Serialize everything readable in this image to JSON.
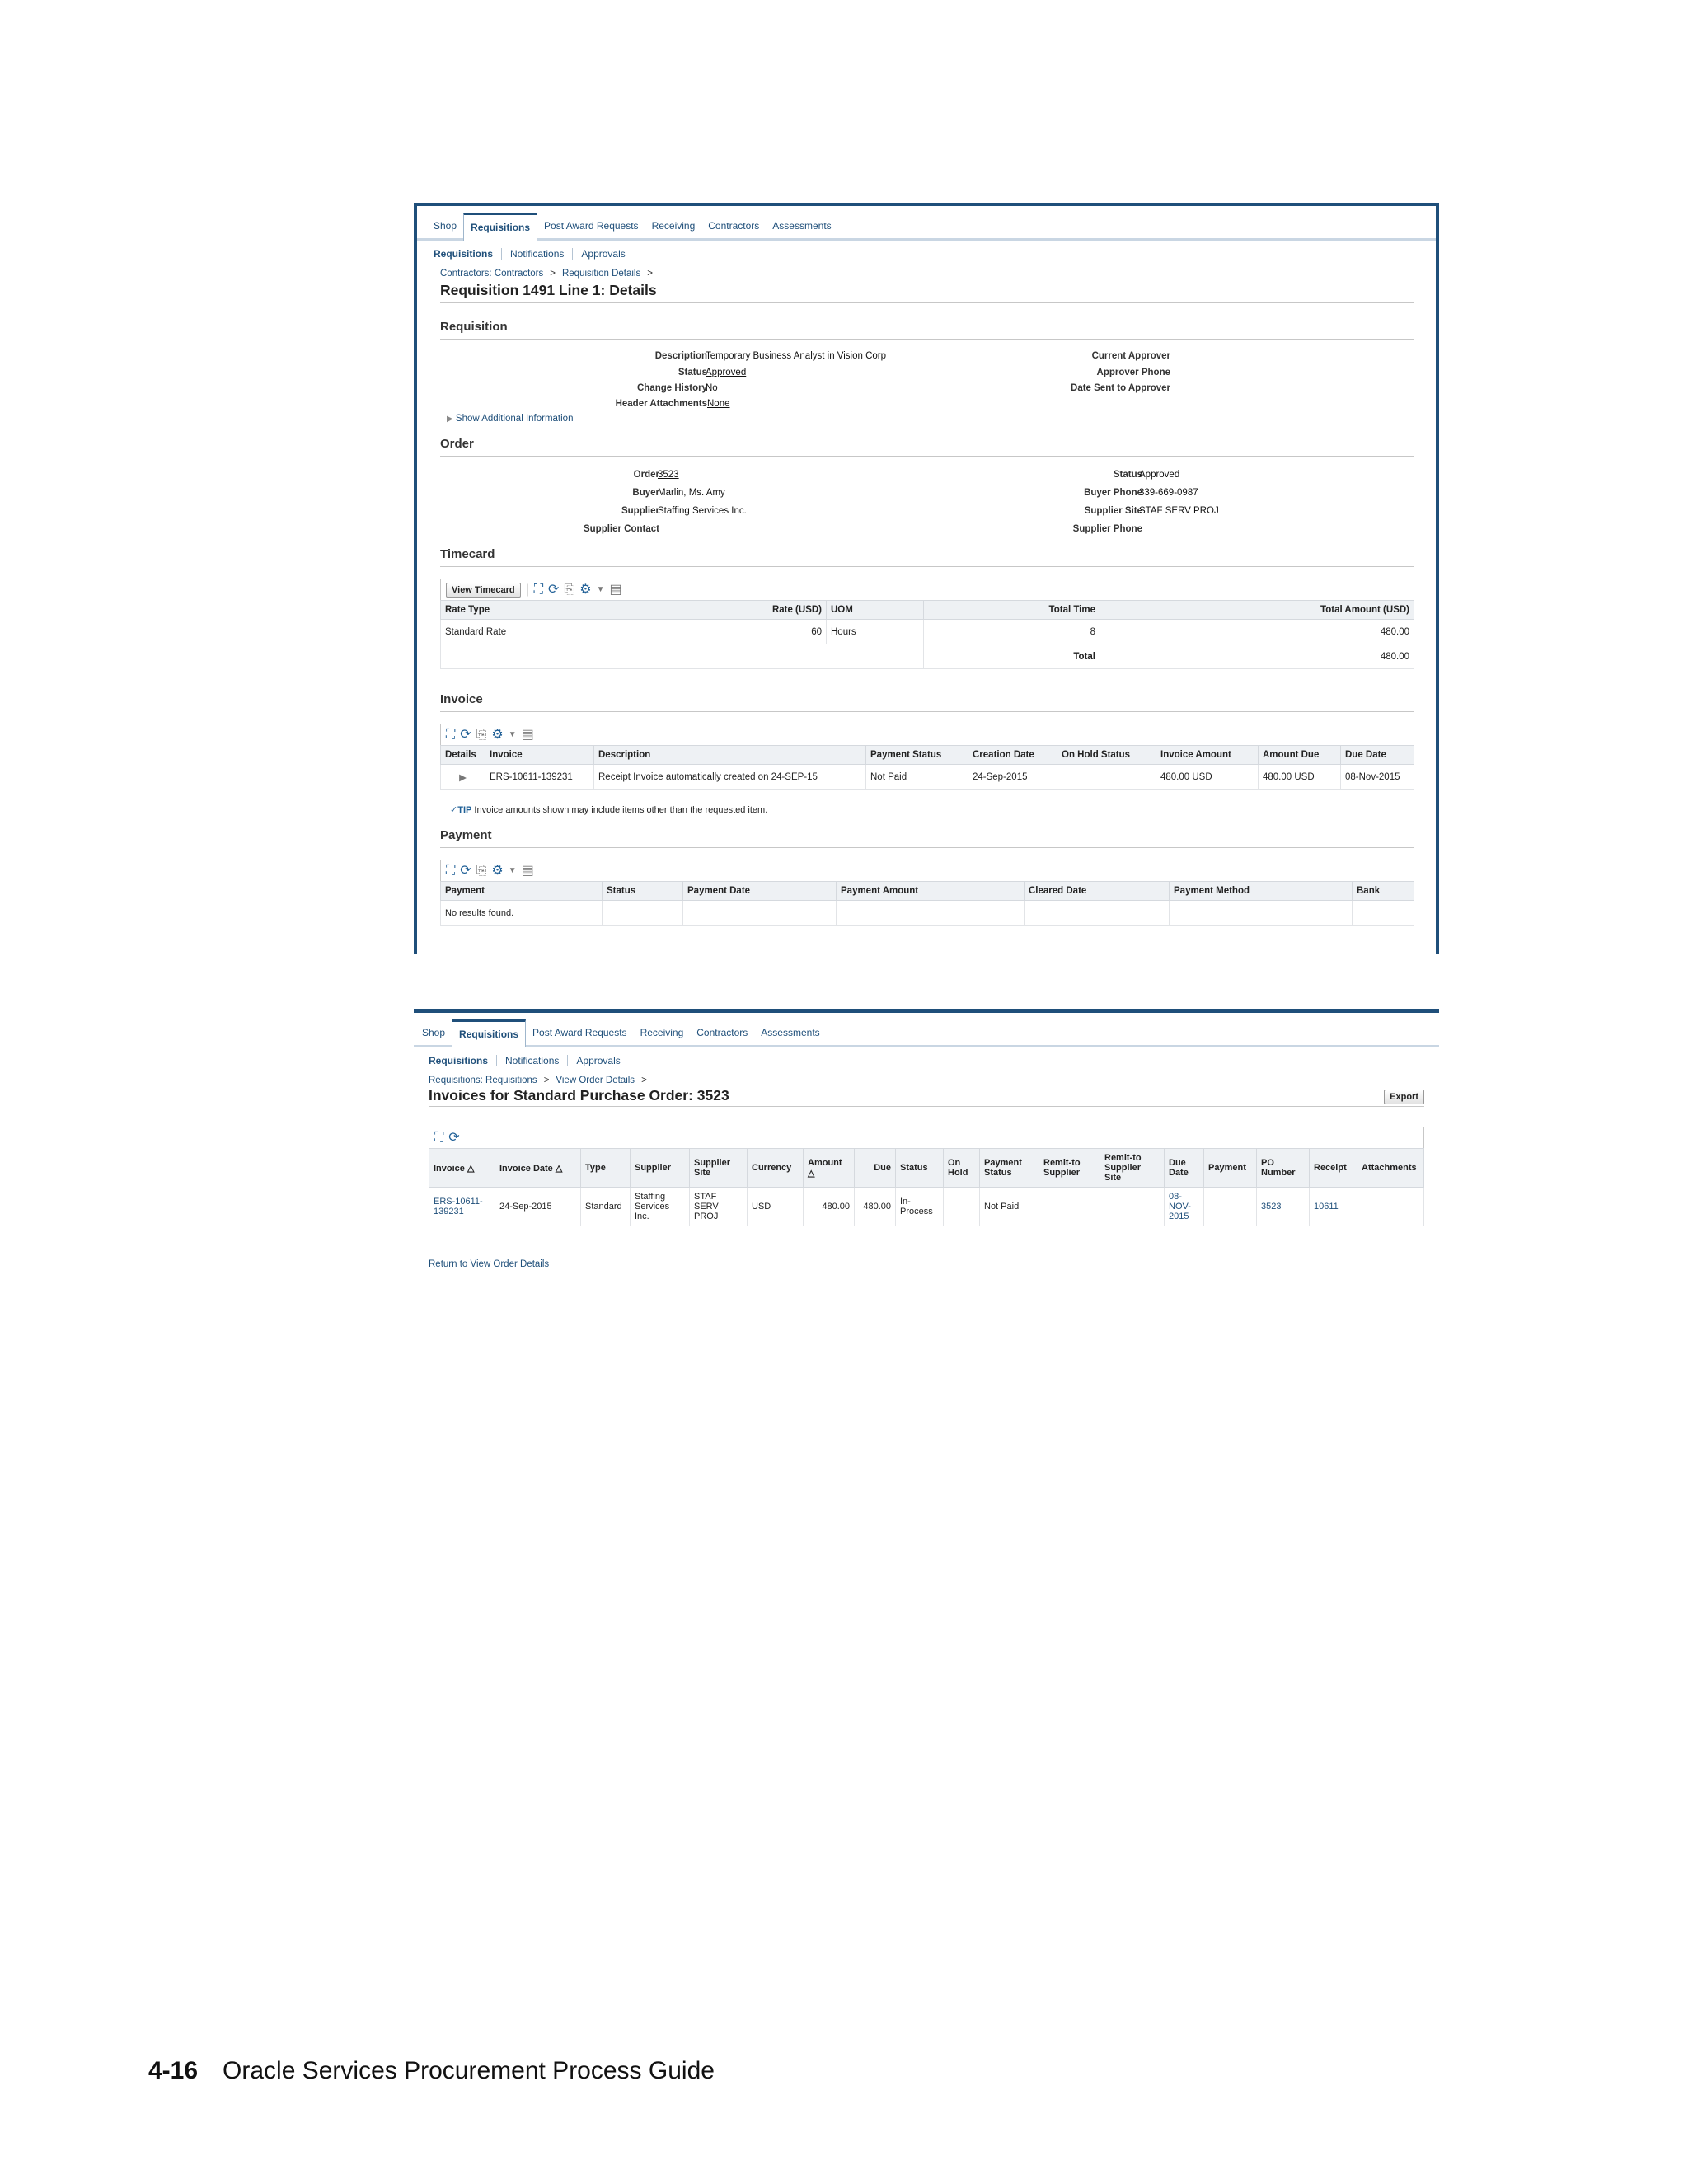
{
  "shot1": {
    "tabs": [
      "Shop",
      "Requisitions",
      "Post Award Requests",
      "Receiving",
      "Contractors",
      "Assessments"
    ],
    "subtabs": [
      "Requisitions",
      "Notifications",
      "Approvals"
    ],
    "breadcrumbs": [
      "Contractors: Contractors",
      "Requisition Details"
    ],
    "title": "Requisition 1491 Line 1: Details",
    "requisition": {
      "heading": "Requisition",
      "description_label": "Description",
      "description": "Temporary Business Analyst in Vision Corp",
      "status_label": "Status",
      "status": "Approved",
      "change_history_label": "Change History",
      "change_history": "No",
      "header_attachments_label": "Header Attachments",
      "header_attachments": "None",
      "current_approver_label": "Current Approver",
      "approver_phone_label": "Approver Phone",
      "date_sent_label": "Date Sent to Approver",
      "show_additional": "Show Additional Information"
    },
    "order": {
      "heading": "Order",
      "order_label": "Order",
      "order": "3523",
      "buyer_label": "Buyer",
      "buyer": "Marlin, Ms. Amy",
      "supplier_label": "Supplier",
      "supplier": "Staffing Services Inc.",
      "supplier_contact_label": "Supplier Contact",
      "status_label": "Status",
      "status": "Approved",
      "buyer_phone_label": "Buyer Phone",
      "buyer_phone": "339-669-0987",
      "supplier_site_label": "Supplier Site",
      "supplier_site": "STAF SERV PROJ",
      "supplier_phone_label": "Supplier Phone"
    },
    "timecard": {
      "heading": "Timecard",
      "view_button": "View Timecard",
      "columns": [
        "Rate Type",
        "Rate (USD)",
        "UOM",
        "Total Time",
        "Total Amount (USD)"
      ],
      "row": [
        "Standard Rate",
        "60",
        "Hours",
        "8",
        "480.00"
      ],
      "total_label": "Total",
      "total": "480.00"
    },
    "invoice": {
      "heading": "Invoice",
      "columns": [
        "Details",
        "Invoice",
        "Description",
        "Payment Status",
        "Creation Date",
        "On Hold Status",
        "Invoice Amount",
        "Amount Due",
        "Due Date"
      ],
      "row": [
        "",
        "ERS-10611-139231",
        "Receipt Invoice automatically created on 24-SEP-15",
        "Not Paid",
        "24-Sep-2015",
        "",
        "480.00 USD",
        "480.00 USD",
        "08-Nov-2015"
      ],
      "tip_label": "TIP",
      "tip": "Invoice amounts shown may include items other than the requested item."
    },
    "payment": {
      "heading": "Payment",
      "columns": [
        "Payment",
        "Status",
        "Payment Date",
        "Payment Amount",
        "Cleared Date",
        "Payment Method",
        "Bank"
      ],
      "empty": "No results found."
    }
  },
  "shot2": {
    "tabs": [
      "Shop",
      "Requisitions",
      "Post Award Requests",
      "Receiving",
      "Contractors",
      "Assessments"
    ],
    "subtabs": [
      "Requisitions",
      "Notifications",
      "Approvals"
    ],
    "breadcrumbs": [
      "Requisitions: Requisitions",
      "View Order Details"
    ],
    "title": "Invoices for Standard Purchase Order: 3523",
    "export_button": "Export",
    "columns": [
      "Invoice △",
      "Invoice Date △",
      "Type",
      "Supplier",
      "Supplier Site",
      "Currency",
      "Amount △",
      "Due",
      "Status",
      "On Hold",
      "Payment Status",
      "Remit-to Supplier",
      "Remit-to Supplier Site",
      "Due Date",
      "Payment",
      "PO Number",
      "Receipt",
      "Attachments"
    ],
    "row": [
      "ERS-10611-139231",
      "24-Sep-2015",
      "Standard",
      "Staffing Services Inc.",
      "STAF SERV PROJ",
      "USD",
      "480.00",
      "480.00",
      "In-Process",
      "",
      "Not Paid",
      "",
      "",
      "08-NOV-2015",
      "",
      "3523",
      "10611",
      ""
    ],
    "return_link": "Return to View Order Details"
  },
  "footer": {
    "page_number": "4-16",
    "book_title": "Oracle Services Procurement Process Guide"
  }
}
